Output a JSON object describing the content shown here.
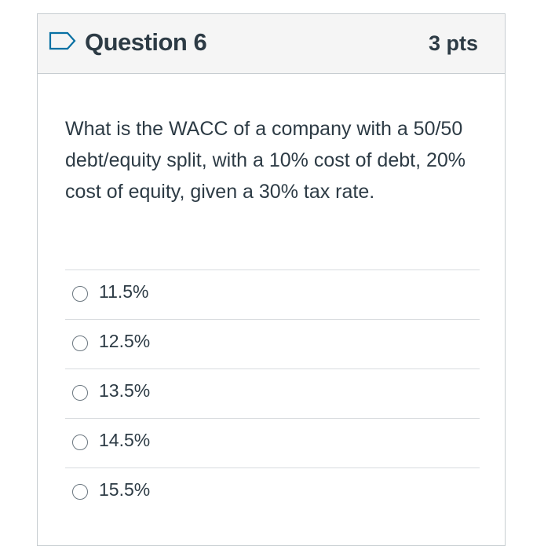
{
  "question": {
    "title": "Question 6",
    "points": "3 pts",
    "text": "What is the WACC of a company with a 50/50 debt/equity split, with a 10% cost of debt, 20% cost of equity, given a 30% tax rate.",
    "flag_icon": "flag-outline-icon"
  },
  "answers": [
    {
      "label": "11.5%",
      "selected": false
    },
    {
      "label": "12.5%",
      "selected": false
    },
    {
      "label": "13.5%",
      "selected": false
    },
    {
      "label": "14.5%",
      "selected": false
    },
    {
      "label": "15.5%",
      "selected": false
    }
  ],
  "colors": {
    "text": "#2d3b45",
    "header_bg": "#f5f5f5",
    "border": "#c7cdd1",
    "flag_stroke": "#0770a3"
  }
}
